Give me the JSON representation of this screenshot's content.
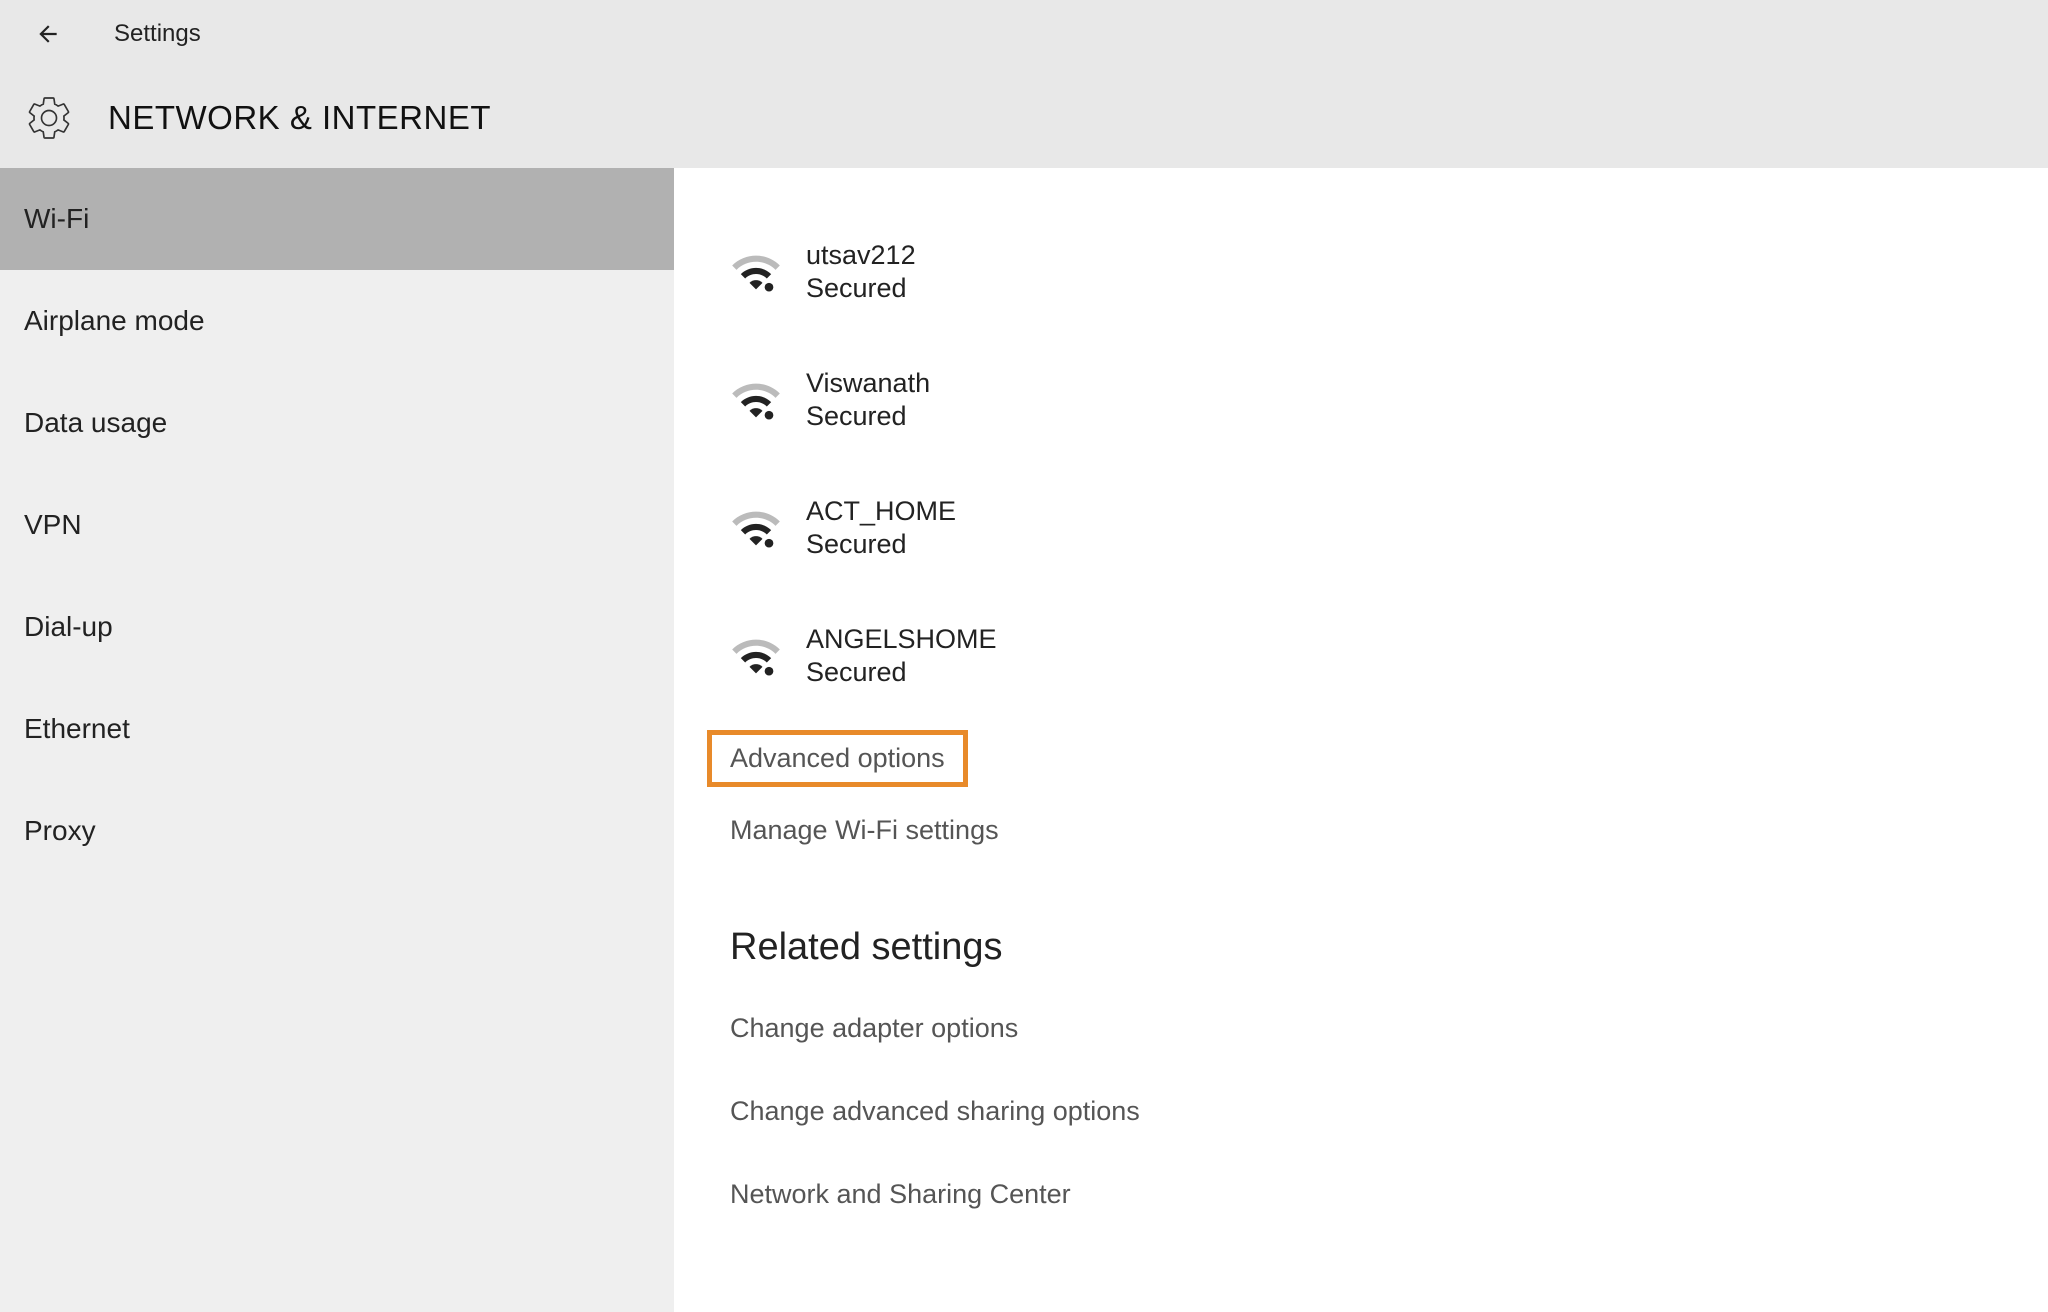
{
  "header": {
    "app_label": "Settings",
    "page_title": "NETWORK & INTERNET"
  },
  "sidebar": {
    "items": [
      {
        "label": "Wi-Fi",
        "selected": true
      },
      {
        "label": "Airplane mode",
        "selected": false
      },
      {
        "label": "Data usage",
        "selected": false
      },
      {
        "label": "VPN",
        "selected": false
      },
      {
        "label": "Dial-up",
        "selected": false
      },
      {
        "label": "Ethernet",
        "selected": false
      },
      {
        "label": "Proxy",
        "selected": false
      }
    ]
  },
  "networks": [
    {
      "name": "utsav212",
      "status": "Secured"
    },
    {
      "name": "Viswanath",
      "status": "Secured"
    },
    {
      "name": "ACT_HOME",
      "status": "Secured"
    },
    {
      "name": "ANGELSHOME",
      "status": "Secured"
    }
  ],
  "links": {
    "advanced_options": "Advanced options",
    "manage_wifi": "Manage Wi-Fi settings"
  },
  "related": {
    "heading": "Related settings",
    "items": [
      "Change adapter options",
      "Change advanced sharing options",
      "Network and Sharing Center"
    ]
  },
  "highlight": {
    "color": "#e88a2a"
  }
}
